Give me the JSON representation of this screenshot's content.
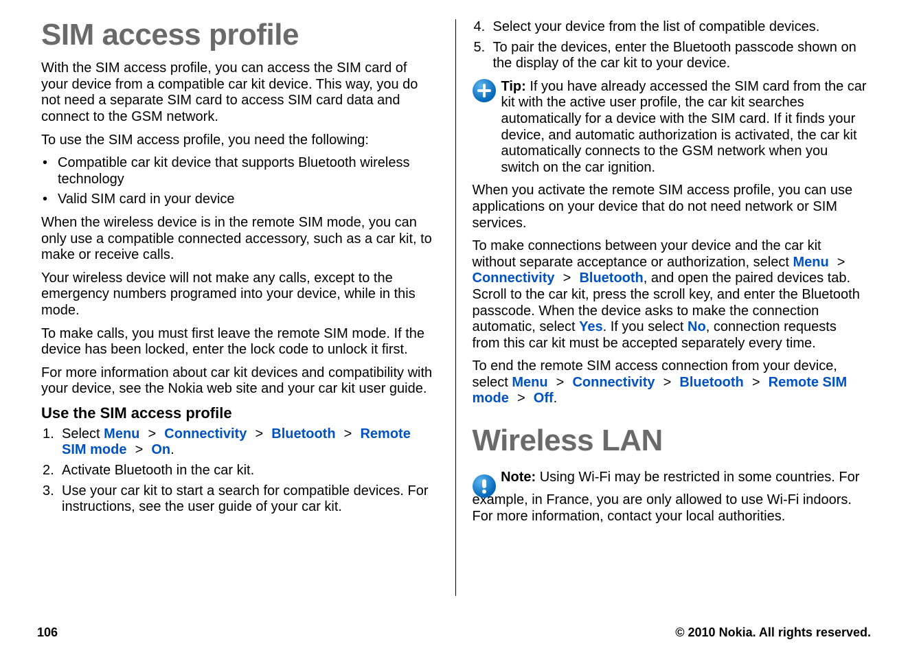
{
  "page_number": "106",
  "copyright": "© 2010 Nokia. All rights reserved.",
  "col_left": {
    "h1": "SIM access profile",
    "p1": "With the SIM access profile, you can access the SIM card of your device from a compatible car kit device. This way, you do not need a separate SIM card to access SIM card data and connect to the GSM network.",
    "p2": "To use the SIM access profile, you need the following:",
    "bullet1": "Compatible car kit device that supports Bluetooth wireless technology",
    "bullet2": "Valid SIM card in your device",
    "p3": "When the wireless device is in the remote SIM mode, you can only use a compatible connected accessory, such as a car kit, to make or receive calls.",
    "p4": "Your wireless device will not make any calls, except to the emergency numbers programed into your device, while in this mode.",
    "p5": "To make calls, you must first leave the remote SIM mode. If the device has been locked, enter the lock code to unlock it first.",
    "p6": "For more information about car kit devices and compatibility with your device, see the Nokia web site and your car kit user guide.",
    "h2_use": "Use the SIM access profile",
    "step1_pre": "Select",
    "step1_path": {
      "a": "Menu",
      "b": "Connectivity",
      "c": "Bluetooth",
      "d": "Remote SIM mode",
      "e": "On"
    },
    "step1_post": ".",
    "step2": "Activate Bluetooth in the car kit.",
    "step3": "Use your car kit to start a search for compatible devices. For instructions, see the user guide of your car kit."
  },
  "col_right": {
    "step4": "Select your device from the list of compatible devices.",
    "step5": "To pair the devices, enter the Bluetooth passcode shown on the display of the car kit to your device.",
    "tip_label": "Tip:",
    "tip_text": " If you have already accessed the SIM card from the car kit with the active user profile, the car kit searches automatically for a device with the SIM card. If it finds your device, and automatic authorization is activated, the car kit automatically connects to the GSM network when you switch on the car ignition.",
    "p1": "When you activate the remote SIM access profile, you can use applications on your device that do not need network or SIM services.",
    "auth": {
      "pre": "To make connections between your device and the car kit without separate acceptance or authorization, select",
      "a": "Menu",
      "b": "Connectivity",
      "c": "Bluetooth",
      "mid": ", and open the paired devices tab. Scroll to the car kit, press the scroll key, and enter the Bluetooth passcode. When the device asks to make the connection automatic, select",
      "yes": "Yes",
      "mid2": ". If you select",
      "no": "No",
      "post": ", connection requests from this car kit must be accepted separately every time."
    },
    "end": {
      "pre": "To end the remote SIM access connection from your device, select",
      "a": "Menu",
      "b": "Connectivity",
      "c": "Bluetooth",
      "d": "Remote SIM mode",
      "e": "Off",
      "post": "."
    },
    "h1_wlan": "Wireless LAN",
    "note_label": "Note:",
    "note_text": "  Using Wi-Fi may be restricted in some countries. For example, in France, you are only allowed to use Wi-Fi indoors. For more information, contact your local authorities."
  }
}
